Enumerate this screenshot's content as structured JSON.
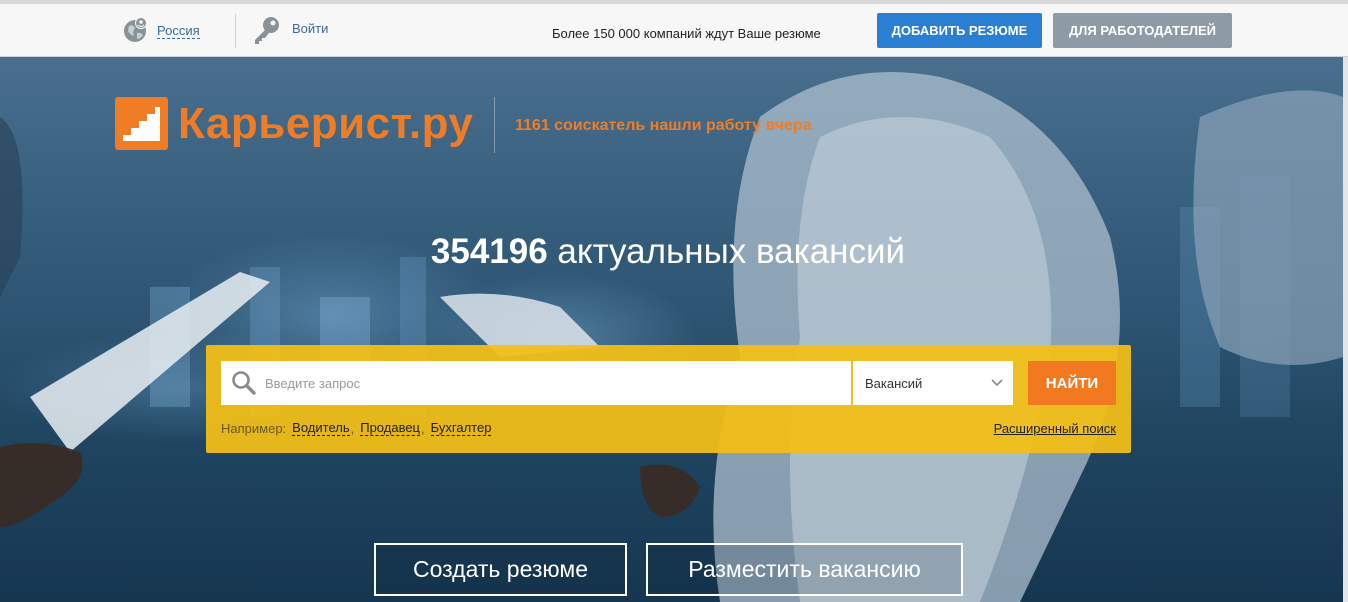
{
  "header": {
    "region_label": "Россия",
    "login_label": "Войти",
    "promo_text": "Более 150 000 компаний ждут Ваше резюме",
    "add_resume_label": "ДОБАВИТЬ РЕЗЮМЕ",
    "employers_label": "ДЛЯ РАБОТОДАТЕЛЕЙ"
  },
  "brand": {
    "logo_text": "Карьерист.ру",
    "tagline": "1161 соискатель нашли работу вчера"
  },
  "hero": {
    "vacancy_count": "354196",
    "vacancy_suffix": " актуальных вакансий"
  },
  "search": {
    "placeholder": "Введите запрос",
    "category_selected": "Вакансий",
    "find_label": "НАЙТИ",
    "examples_label": "Например:",
    "examples": [
      "Водитель",
      "Продавец",
      "Бухгалтер"
    ],
    "advanced_label": "Расширенный поиск"
  },
  "actions": {
    "create_resume_label": "Создать резюме",
    "post_vacancy_label": "Разместить вакансию"
  },
  "colors": {
    "accent_orange": "#f07c26",
    "button_blue": "#2b7fd3",
    "button_gray": "#8e9ba6",
    "search_yellow": "#f4c014",
    "find_orange": "#f27920"
  },
  "icons": {
    "region": "globe-pin-icon",
    "login": "key-icon",
    "search": "magnifier-icon",
    "select": "chevron-down-icon",
    "logo": "stairs-logo-icon"
  }
}
